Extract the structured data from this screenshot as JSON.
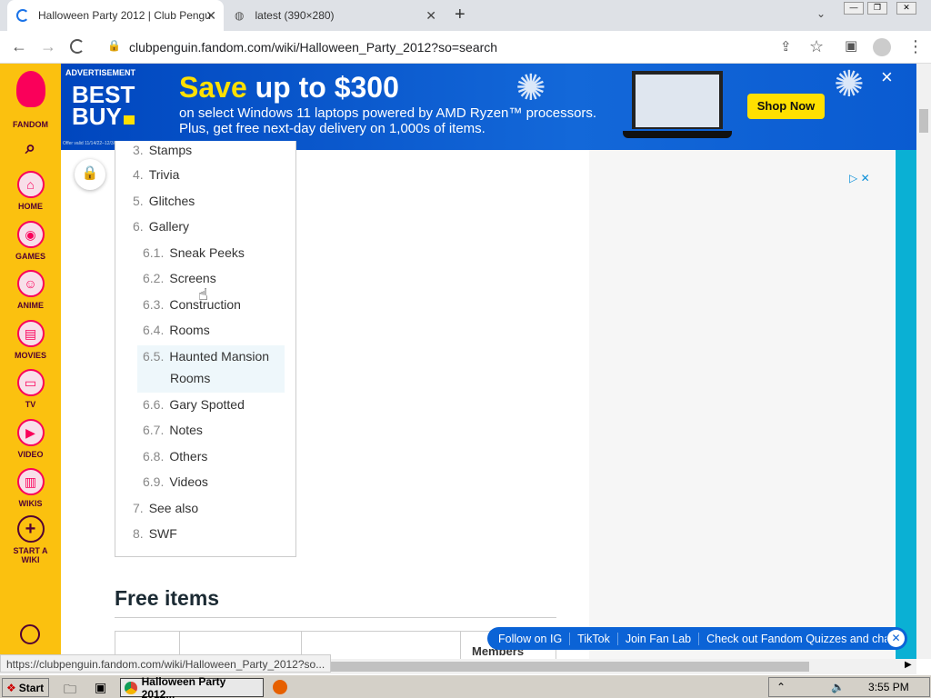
{
  "browser": {
    "tabs": [
      {
        "title": "Halloween Party 2012 | Club Pengu",
        "active": true
      },
      {
        "title": "latest (390×280)",
        "active": false
      }
    ],
    "new_tab": "+",
    "url": "clubpenguin.fandom.com/wiki/Halloween_Party_2012?so=search",
    "status_url": "https://clubpenguin.fandom.com/wiki/Halloween_Party_2012?so..."
  },
  "ad": {
    "label": "ADVERTISEMENT",
    "brand_line1": "BEST",
    "brand_line2": "BUY",
    "headline_a": "Save",
    "headline_b": "up to $300",
    "sub1": "on select Windows 11 laptops powered by AMD Ryzen™ processors.",
    "sub2": "Plus, get free next-day delivery on 1,000s of items.",
    "fine_print": "Offer valid 11/14/22–12/3/22. Minimum savings is $30. © 2022 Best Buy",
    "cta": "Shop Now",
    "close": "×"
  },
  "sidebar": {
    "logo": "FANDOM",
    "items": [
      "HOME",
      "GAMES",
      "ANIME",
      "MOVIES",
      "TV",
      "VIDEO",
      "WIKIS"
    ],
    "start_wiki": "START A WIKI"
  },
  "toc": [
    {
      "n": "3.",
      "t": "Stamps"
    },
    {
      "n": "4.",
      "t": "Trivia"
    },
    {
      "n": "5.",
      "t": "Glitches"
    },
    {
      "n": "6.",
      "t": "Gallery"
    },
    {
      "n": "6.1.",
      "t": "Sneak Peeks"
    },
    {
      "n": "6.2.",
      "t": "Screens"
    },
    {
      "n": "6.3.",
      "t": "Construction"
    },
    {
      "n": "6.4.",
      "t": "Rooms"
    },
    {
      "n": "6.5.",
      "t": "Haunted Mansion"
    },
    {
      "n": "",
      "t": "Rooms"
    },
    {
      "n": "6.6.",
      "t": "Gary Spotted"
    },
    {
      "n": "6.7.",
      "t": "Notes"
    },
    {
      "n": "6.8.",
      "t": "Others"
    },
    {
      "n": "6.9.",
      "t": "Videos"
    },
    {
      "n": "7.",
      "t": "See also"
    },
    {
      "n": "8.",
      "t": "SWF"
    }
  ],
  "section_title": "Free items",
  "table_header_partial": "Members",
  "follow_bar": [
    "Follow on IG",
    "TikTok",
    "Join Fan Lab",
    "Check out Fandom Quizzes and cha"
  ],
  "taskbar": {
    "start": "Start",
    "window": "Halloween Party 2012...",
    "time": "3:55 PM"
  }
}
